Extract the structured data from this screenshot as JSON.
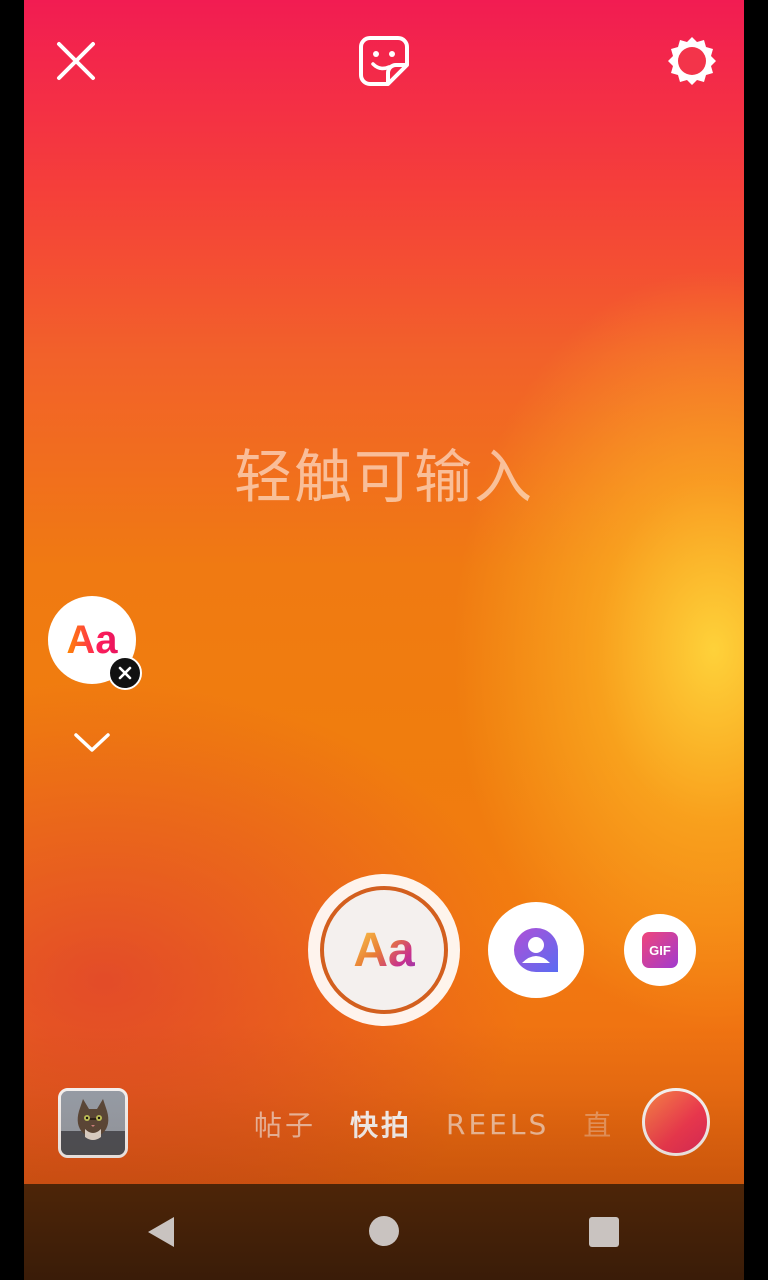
{
  "top_bar": {
    "close_icon": "close-icon",
    "sticker_icon": "sticker-icon",
    "settings_icon": "settings-gear-icon"
  },
  "canvas": {
    "prompt": "轻触可输入"
  },
  "text_style": {
    "label": "Aa"
  },
  "create_tools": {
    "main_label": "Aa",
    "mention_icon": "mention-icon",
    "gif_label": "GIF"
  },
  "bottom_bar": {
    "modes": [
      "帖子",
      "快拍",
      "REELS",
      "直"
    ],
    "active_mode": "快拍"
  },
  "colors": {
    "accent_pink": "#f21c52",
    "accent_orange": "#f07a12",
    "highlight_yellow": "#ffd63c",
    "mention_purple": "#8a5cf6",
    "gif_pink": "#e03a8e"
  }
}
